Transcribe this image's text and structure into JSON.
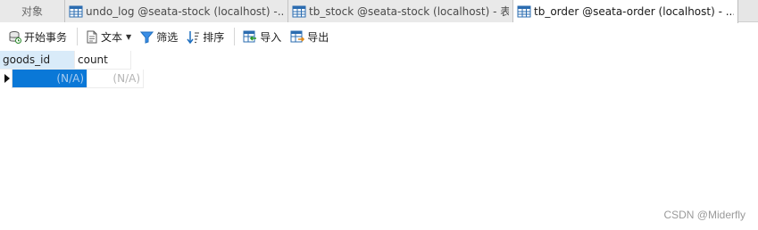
{
  "tabs": [
    {
      "label": "对象",
      "active": false
    },
    {
      "label": "undo_log @seata-stock (localhost) -...",
      "active": false
    },
    {
      "label": "tb_stock @seata-stock (localhost) - 表",
      "active": false
    },
    {
      "label": "tb_order @seata-order (localhost) - ...",
      "active": true
    }
  ],
  "toolbar": {
    "begin_transaction": "开始事务",
    "text": "文本",
    "filter": "筛选",
    "sort": "排序",
    "import": "导入",
    "export": "导出"
  },
  "grid": {
    "columns": [
      "goods_id",
      "count"
    ],
    "rows": [
      [
        "(N/A)",
        "(N/A)"
      ]
    ]
  },
  "watermark": "CSDN @Miderfly",
  "colors": {
    "selected_cell": "#0a78d7",
    "header_highlight": "#d9ebf9",
    "tab_bar": "#e6e6e6",
    "active_tab": "#ffffff"
  }
}
